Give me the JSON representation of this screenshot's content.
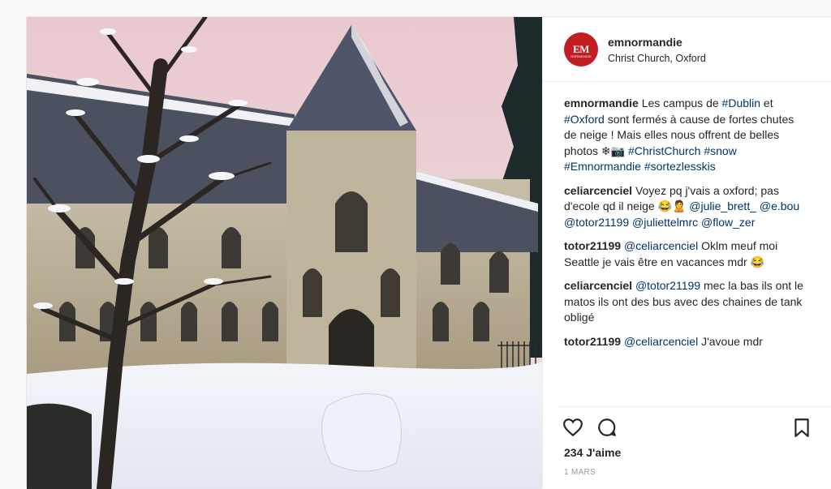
{
  "post": {
    "username": "emnormandie",
    "location": "Christ Church, Oxford",
    "avatar_text": "EM",
    "avatar_subtext": "NORMANDIE"
  },
  "comments": [
    {
      "author": "emnormandie",
      "parts": [
        {
          "t": "Les campus de "
        },
        {
          "t": "#Dublin",
          "tag": true
        },
        {
          "t": " et "
        },
        {
          "t": "#Oxford",
          "tag": true
        },
        {
          "t": " sont fermés à cause de fortes chutes de neige ! Mais elles nous offrent de belles photos ❄📷 "
        },
        {
          "t": "#ChristChurch",
          "tag": true
        },
        {
          "t": " "
        },
        {
          "t": "#snow",
          "tag": true
        },
        {
          "t": " "
        },
        {
          "t": "#Emnormandie",
          "tag": true
        },
        {
          "t": " "
        },
        {
          "t": "#sortezlesskis",
          "tag": true
        }
      ]
    },
    {
      "author": "celiarcenciel",
      "parts": [
        {
          "t": "Voyez pq j'vais a oxford; pas d'ecole qd il neige 😂🙎 "
        },
        {
          "t": "@julie_brett_",
          "tag": true
        },
        {
          "t": " "
        },
        {
          "t": "@e.bou",
          "tag": true
        },
        {
          "t": " "
        },
        {
          "t": "@totor21199",
          "tag": true
        },
        {
          "t": " "
        },
        {
          "t": "@juliettelmrc",
          "tag": true
        },
        {
          "t": " "
        },
        {
          "t": "@flow_zer",
          "tag": true
        }
      ]
    },
    {
      "author": "totor21199",
      "parts": [
        {
          "t": "@celiarcenciel",
          "tag": true
        },
        {
          "t": " Oklm meuf moi Seattle je vais être en vacances mdr 😂"
        }
      ]
    },
    {
      "author": "celiarcenciel",
      "parts": [
        {
          "t": "@totor21199",
          "tag": true
        },
        {
          "t": " mec la bas ils ont le matos ils ont des bus avec des chaines de tank obligé"
        }
      ]
    },
    {
      "author": "totor21199",
      "parts": [
        {
          "t": "@celiarcenciel",
          "tag": true
        },
        {
          "t": " J'avoue mdr"
        }
      ]
    }
  ],
  "actions": {
    "like_icon": "heart-icon",
    "comment_icon": "comment-bubble-icon",
    "save_icon": "bookmark-icon"
  },
  "likes_text": "234 J'aime",
  "date_text": "1 MARS",
  "colors": {
    "tag": "#003569",
    "avatar_bg": "#c21d23",
    "sky": "#e8d6da"
  }
}
